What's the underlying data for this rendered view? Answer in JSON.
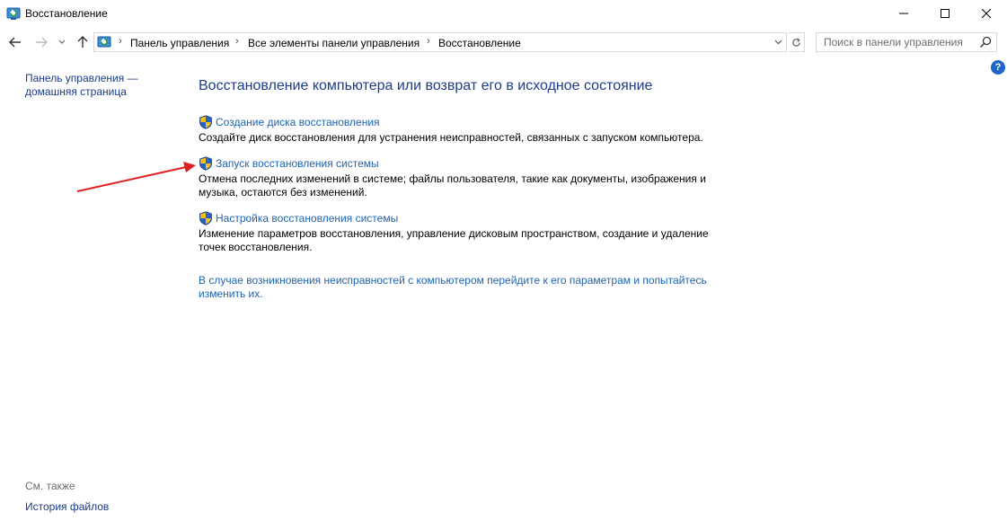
{
  "window": {
    "title": "Восстановление"
  },
  "address": {
    "crumbs": [
      "Панель управления",
      "Все элементы панели управления",
      "Восстановление"
    ]
  },
  "search": {
    "placeholder": "Поиск в панели управления"
  },
  "help": {
    "label": "?"
  },
  "leftpane": {
    "home_link": "Панель управления — домашняя страница",
    "see_also": "См. также",
    "file_history": "История файлов"
  },
  "main": {
    "title": "Восстановление компьютера или возврат его в исходное состояние",
    "tasks": [
      {
        "link": "Создание диска восстановления",
        "description": "Создайте диск восстановления для устранения неисправностей, связанных с запуском компьютера."
      },
      {
        "link": "Запуск восстановления системы",
        "description": "Отмена последних изменений в системе; файлы пользователя, такие как документы, изображения и музыка, остаются без изменений."
      },
      {
        "link": "Настройка восстановления системы",
        "description": "Изменение параметров восстановления, управление дисковым пространством, создание и удаление точек восстановления."
      }
    ],
    "troubleshoot_link": "В случае возникновения неисправностей с компьютером перейдите к его параметрам и попытайтесь изменить их."
  },
  "colors": {
    "link": "#1e64b4",
    "title": "#1e3c8c",
    "annotation_arrow": "#e02020"
  }
}
